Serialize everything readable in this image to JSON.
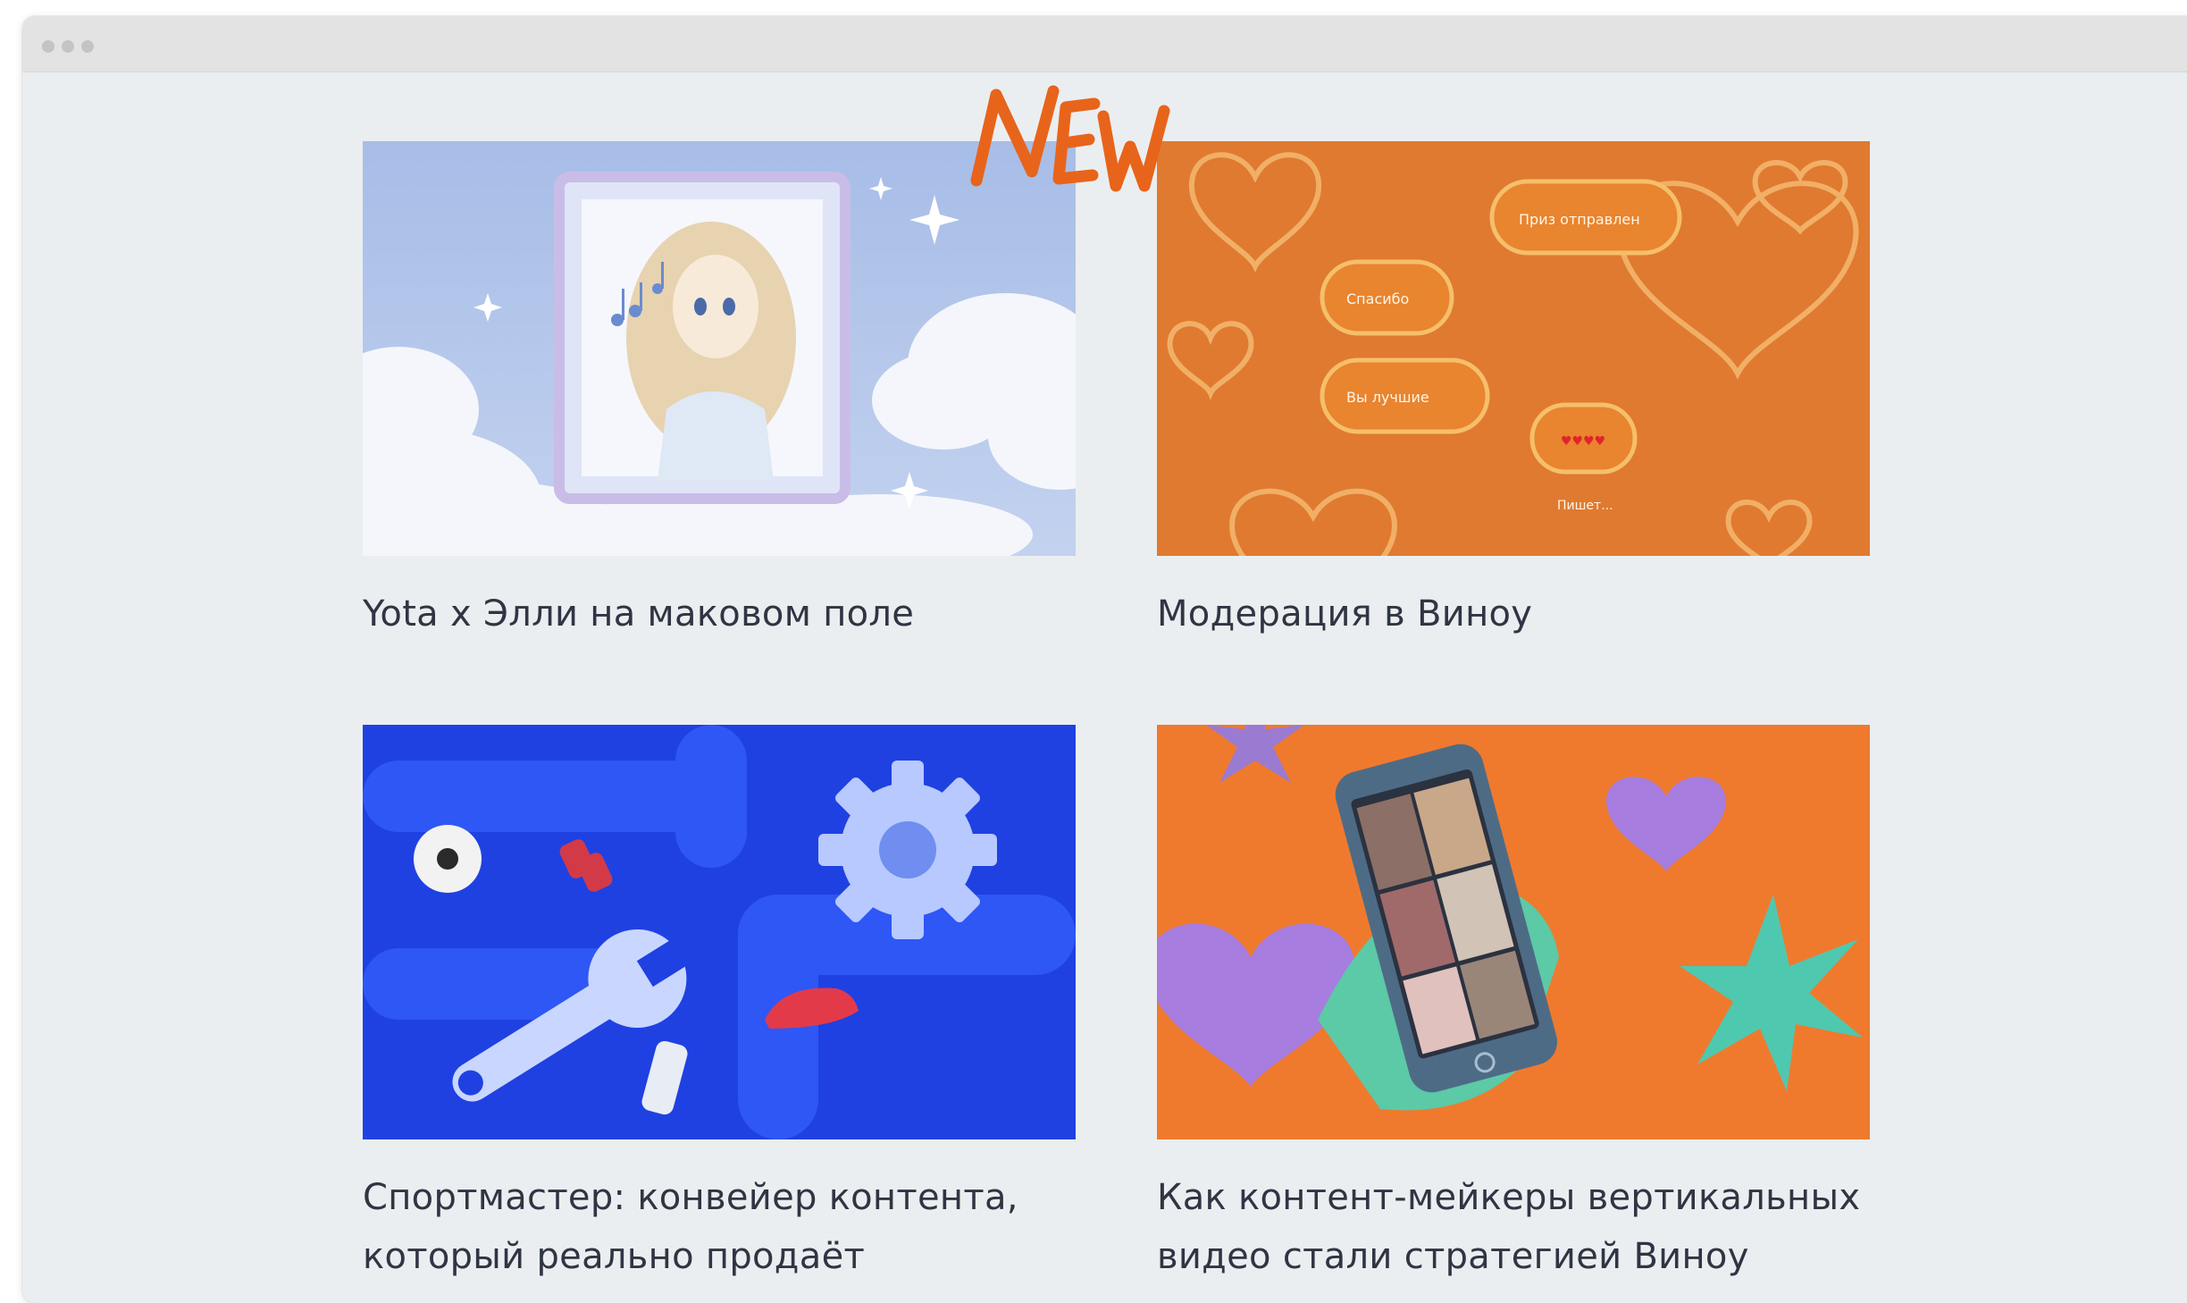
{
  "window": {
    "controls": [
      "close",
      "minimize",
      "maximize"
    ]
  },
  "badge": {
    "text": "NEW",
    "color": "#e8641b"
  },
  "colors": {
    "background": "#ebeef0",
    "title_text": "#2f3543",
    "orange": "#e07a30",
    "blue": "#1e3fe0"
  },
  "cards": [
    {
      "title": "Yota x Элли на маковом поле",
      "image": "anime-girl-in-frame-clouds"
    },
    {
      "title": "Модерация в Виноу",
      "image": "orange-hearts-chat-bubbles",
      "bubbles": [
        "Приз отправлен",
        "Спасибо",
        "Вы лучшие",
        "♥♥♥♥",
        "Пишет..."
      ]
    },
    {
      "title": "Спортмастер: конвейер контента,\nкоторый реально продаёт",
      "image": "blue-pipes-gear-wrench"
    },
    {
      "title": "Как контент-мейкеры вертикальных\nвидео стали стратегией Виноу",
      "image": "phone-hand-hearts-stars"
    }
  ]
}
